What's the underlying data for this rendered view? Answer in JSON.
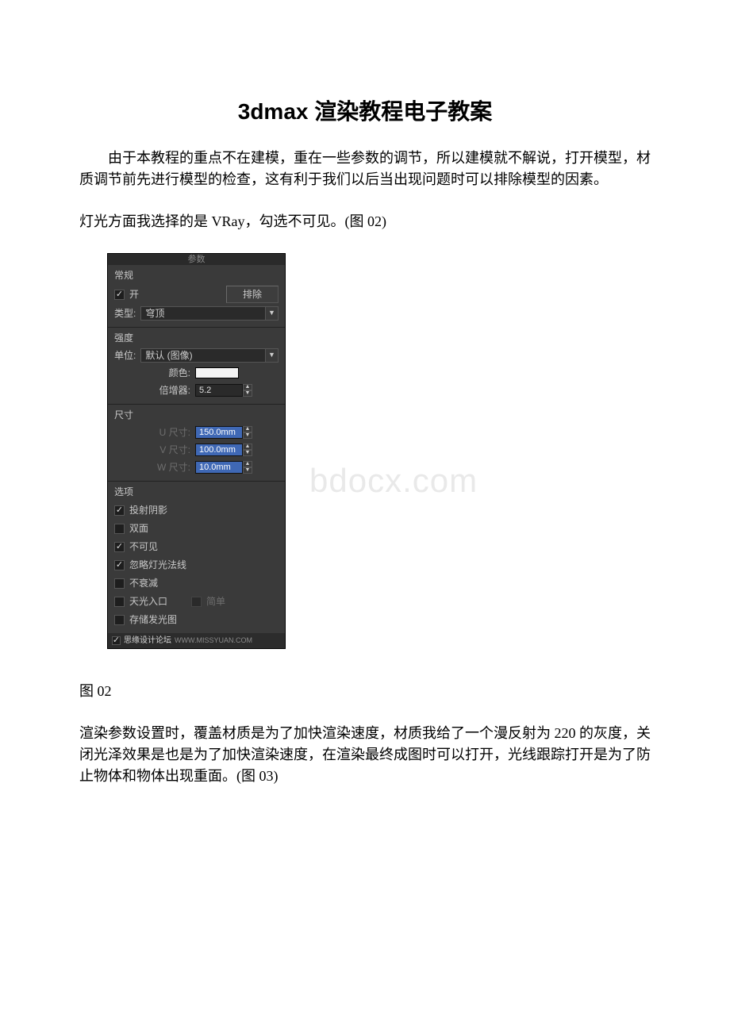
{
  "doc": {
    "title": "3dmax 渲染教程电子教案",
    "intro": "由于本教程的重点不在建模，重在一些参数的调节，所以建模就不解说，打开模型，材质调节前先进行模型的检查，这有利于我们以后当出现问题时可以排除模型的因素。",
    "light_line": "灯光方面我选择的是 VRay，勾选不可见。(图 02)",
    "fig02": "图 02",
    "closing": "渲染参数设置时，覆盖材质是为了加快渲染速度，材质我给了一个漫反射为 220 的灰度，关闭光泽效果是也是为了加快渲染速度，在渲染最终成图时可以打开，光线跟踪打开是为了防止物体和物体出现重面。(图 03)",
    "watermark": "bdocx.com"
  },
  "panel": {
    "header": "参数",
    "general": {
      "title": "常规",
      "on": "开",
      "exclude": "排除",
      "type_label": "类型:",
      "type_value": "穹顶"
    },
    "intensity": {
      "title": "强度",
      "unit_label": "单位:",
      "unit_value": "默认 (图像)",
      "color_label": "颜色:",
      "mult_label": "倍增器:",
      "mult_value": "5.2"
    },
    "size": {
      "title": "尺寸",
      "u_label": "U 尺寸:",
      "u_value": "150.0mm",
      "v_label": "V 尺寸:",
      "v_value": "100.0mm",
      "w_label": "W 尺寸:",
      "w_value": "10.0mm"
    },
    "options": {
      "title": "选项",
      "cast_shadows": "投射阴影",
      "double_sided": "双面",
      "invisible": "不可见",
      "ignore_normals": "忽略灯光法线",
      "no_decay": "不衰减",
      "sky_portal": "天光入口",
      "simple": "简单",
      "store_glow": "存储发光图",
      "footer": "思缘设计论坛",
      "footer_wm": "WWW.MISSYUAN.COM"
    }
  }
}
